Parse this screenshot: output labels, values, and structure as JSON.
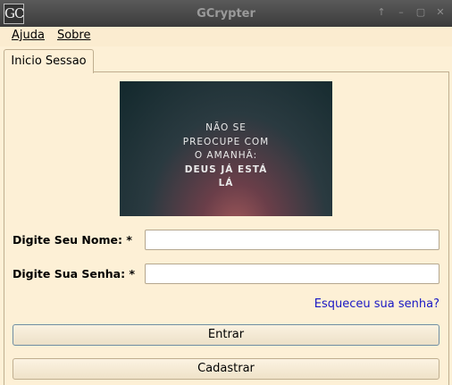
{
  "window": {
    "title": "GCrypter",
    "icon_text": "GC",
    "controls": [
      "↑",
      "–",
      "▢",
      "✕"
    ]
  },
  "menubar": {
    "items": [
      {
        "label": "Ajuda"
      },
      {
        "label": "Sobre"
      }
    ]
  },
  "tabs": [
    {
      "label": "Inicio Sessao",
      "active": true
    }
  ],
  "image": {
    "lines": [
      "NÃO SE",
      "PREOCUPE COM",
      "O AMANHÃ:",
      "DEUS JÁ ESTÁ",
      "LÁ"
    ]
  },
  "form": {
    "name_label": "Digite Seu Nome: *",
    "password_label": "Digite Sua Senha: *",
    "name_value": "",
    "password_value": "",
    "forgot_link": "Esqueceu sua senha?",
    "login_button": "Entrar",
    "register_button": "Cadastrar"
  },
  "colors": {
    "background": "#fdf0d6",
    "link": "#1a18c4"
  }
}
